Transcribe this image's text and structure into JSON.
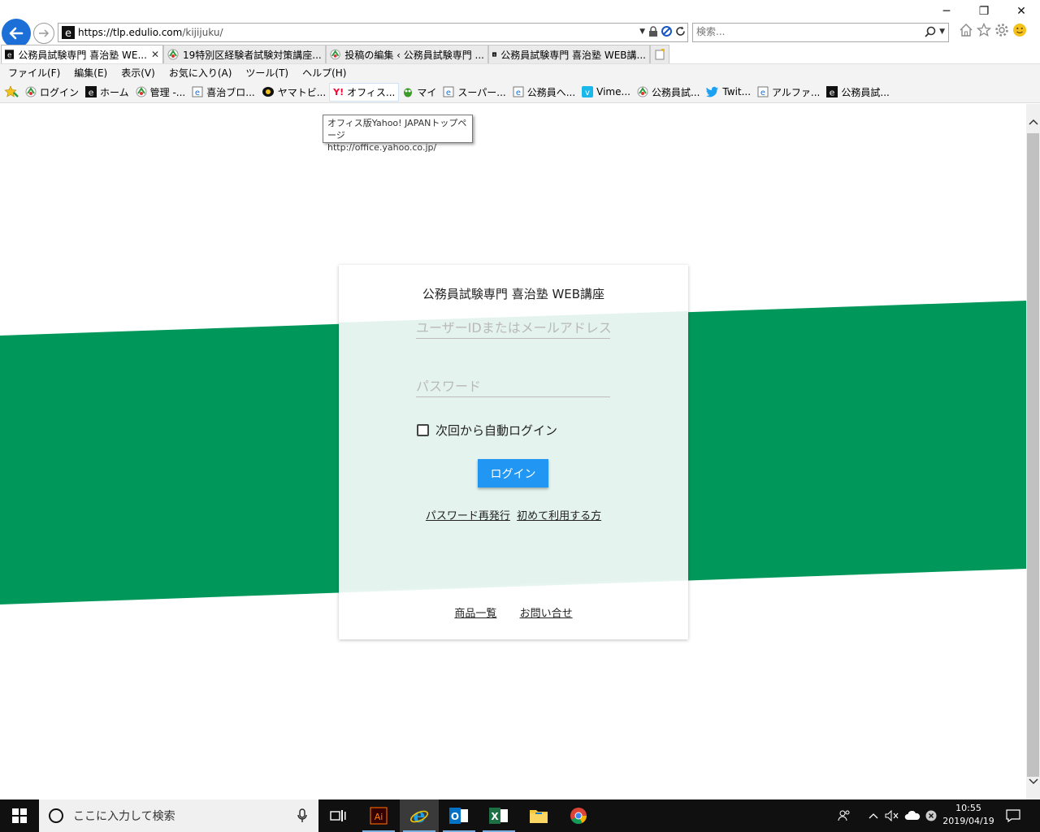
{
  "browser": {
    "url_host": "https://tlp.edulio.com",
    "url_path": "/kijijuku/",
    "search_placeholder": "検索..."
  },
  "tabs": [
    {
      "label": "公務員試験専門 喜治塾 WE...",
      "active": true
    },
    {
      "label": "19特別区経験者試験対策講座..."
    },
    {
      "label": "投稿の編集 ‹ 公務員試験専門 ..."
    },
    {
      "label": "公務員試験専門 喜治塾 WEB講..."
    }
  ],
  "menu": [
    "ファイル(F)",
    "編集(E)",
    "表示(V)",
    "お気に入り(A)",
    "ツール(T)",
    "ヘルプ(H)"
  ],
  "favorites": [
    "ログイン",
    "ホーム",
    "管理 -...",
    "喜治ブロ...",
    "ヤマトビ...",
    "オフィス...",
    "マイ",
    "スーパー...",
    "公務員へ...",
    "Vime...",
    "公務員試...",
    "Twit...",
    "アルファ...",
    "公務員試..."
  ],
  "tooltip": {
    "line1": "オフィス版Yahoo! JAPANトップページ",
    "line2": "http://office.yahoo.co.jp/"
  },
  "login": {
    "title": "公務員試験専門 喜治塾 WEB講座",
    "user_placeholder": "ユーザーIDまたはメールアドレス",
    "password_placeholder": "パスワード",
    "auto_login": "次回から自動ログイン",
    "button": "ログイン",
    "reset_link": "パスワード再発行",
    "first_time_link": "初めて利用する方",
    "products_link": "商品一覧",
    "contact_link": "お問い合せ"
  },
  "colors": {
    "stripe": "#00985a",
    "button": "#2196f3"
  },
  "taskbar": {
    "search_placeholder": "ここに入力して検索",
    "time": "10:55",
    "date": "2019/04/19"
  }
}
